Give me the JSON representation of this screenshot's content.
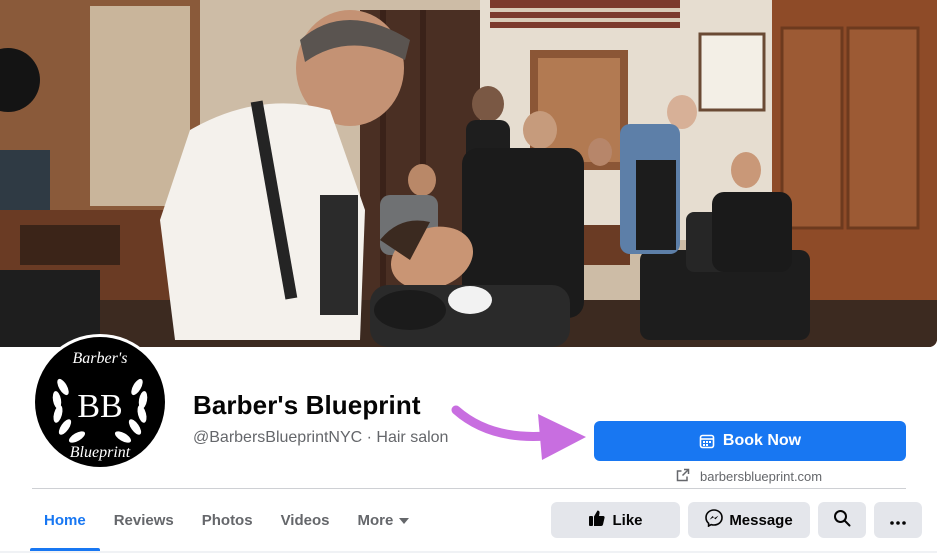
{
  "page": {
    "name": "Barber's Blueprint",
    "handle": "@BarbersBlueprintNYC · Hair salon",
    "avatar_logo_top": "Barber's",
    "avatar_logo_initials": "BB",
    "avatar_logo_bottom": "Blueprint"
  },
  "cta": {
    "book_label": "Book Now",
    "website": "barbersblueprint.com"
  },
  "tabs": [
    {
      "label": "Home",
      "active": true
    },
    {
      "label": "Reviews",
      "active": false
    },
    {
      "label": "Photos",
      "active": false
    },
    {
      "label": "Videos",
      "active": false
    },
    {
      "label": "More",
      "active": false
    }
  ],
  "actions": {
    "like_label": "Like",
    "message_label": "Message"
  },
  "colors": {
    "accent": "#1877f2",
    "button_gray": "#e4e6eb",
    "muted_text": "#65676b",
    "arrow": "#c86ee0"
  },
  "icons": [
    "calendar-icon",
    "external-link-icon",
    "thumbs-up-icon",
    "messenger-icon",
    "search-icon",
    "more-dots-icon",
    "chevron-down-icon",
    "pointer-arrow"
  ]
}
